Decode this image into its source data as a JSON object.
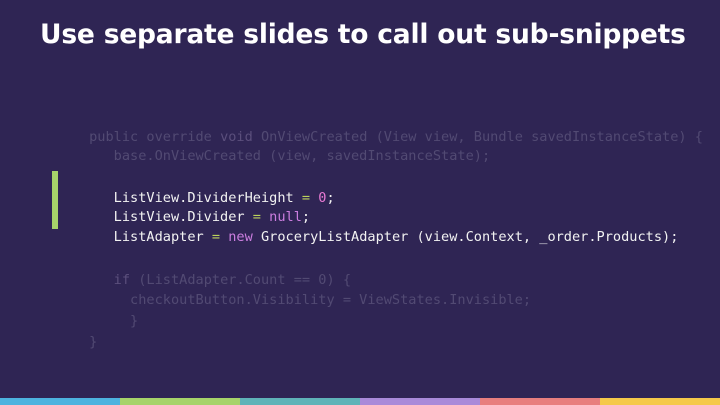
{
  "slide": {
    "title": "Use separate slides to call out sub-snippets"
  },
  "code": {
    "context_before": [
      {
        "segments": [
          {
            "t": "public override ",
            "c": "dim"
          },
          {
            "t": "void",
            "c": "kw"
          },
          {
            "t": " OnViewCreated (View view, Bundle savedInstanceState) {",
            "c": "dim"
          }
        ]
      },
      {
        "segments": [
          {
            "t": "   base.OnViewCreated (view, savedInstanceState);",
            "c": "dim"
          }
        ]
      }
    ],
    "highlighted": [
      {
        "segments": [
          {
            "t": "   ListView.DividerHeight ",
            "c": "plain"
          },
          {
            "t": "=",
            "c": "op"
          },
          {
            "t": " ",
            "c": "plain"
          },
          {
            "t": "0",
            "c": "num"
          },
          {
            "t": ";",
            "c": "plain"
          }
        ]
      },
      {
        "segments": [
          {
            "t": "   ListView.Divider ",
            "c": "plain"
          },
          {
            "t": "=",
            "c": "op"
          },
          {
            "t": " ",
            "c": "plain"
          },
          {
            "t": "null",
            "c": "kwh"
          },
          {
            "t": ";",
            "c": "plain"
          }
        ]
      },
      {
        "segments": [
          {
            "t": "   ListAdapter ",
            "c": "plain"
          },
          {
            "t": "=",
            "c": "op"
          },
          {
            "t": " ",
            "c": "plain"
          },
          {
            "t": "new",
            "c": "kwh"
          },
          {
            "t": " GroceryListAdapter (view.Context, _order.Products);",
            "c": "plain"
          }
        ]
      }
    ],
    "context_after": [
      {
        "segments": [
          {
            "t": "   ",
            "c": "dim"
          },
          {
            "t": "if",
            "c": "kw"
          },
          {
            "t": " (ListAdapter.Count == 0) {",
            "c": "dim"
          }
        ]
      },
      {
        "segments": [
          {
            "t": "     checkoutButton.Visibility = ViewStates.Invisible;",
            "c": "dim"
          }
        ]
      },
      {
        "segments": [
          {
            "t": "     }",
            "c": "dim"
          }
        ]
      },
      {
        "segments": [
          {
            "t": "}",
            "c": "dim"
          }
        ]
      }
    ]
  },
  "colors": {
    "background": "#2f2554",
    "highlight_bar": "#a6d36a",
    "footer_strip": [
      "#4db3df",
      "#a6d36a",
      "#5fb3b8",
      "#a98ad9",
      "#e87e7e",
      "#f5c94a"
    ]
  }
}
